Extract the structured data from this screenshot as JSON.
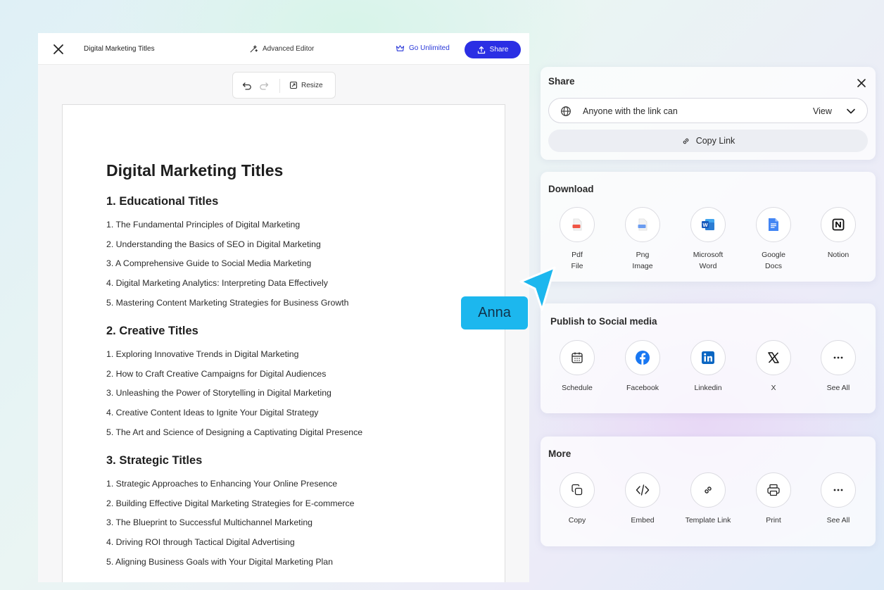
{
  "editor": {
    "doc_name": "Digital Marketing Titles",
    "advanced_editor": "Advanced Editor",
    "go_unlimited": "Go Unlimited",
    "share": "Share",
    "resize": "Resize"
  },
  "document": {
    "title": "Digital Marketing Titles",
    "sections": [
      {
        "heading": "1. Educational Titles",
        "items": [
          "1. The Fundamental Principles of Digital Marketing",
          "2. Understanding the Basics of SEO in Digital Marketing",
          "3. A Comprehensive Guide to Social Media Marketing",
          "4. Digital Marketing Analytics: Interpreting Data Effectively",
          "5. Mastering Content Marketing Strategies for Business Growth"
        ]
      },
      {
        "heading": "2. Creative Titles",
        "items": [
          "1. Exploring Innovative Trends in Digital Marketing",
          "2. How to Craft Creative Campaigns for Digital Audiences",
          "3. Unleashing the Power of Storytelling in Digital Marketing",
          "4. Creative Content Ideas to Ignite Your Digital Strategy",
          "5. The Art and Science of Designing a Captivating Digital Presence"
        ]
      },
      {
        "heading": "3. Strategic Titles",
        "items": [
          "1. Strategic Approaches to Enhancing Your Online Presence",
          "2. Building Effective Digital Marketing Strategies for E-commerce",
          "3. The Blueprint to Successful Multichannel Marketing",
          "4. Driving ROI through Tactical Digital Advertising",
          "5. Aligning Business Goals with Your Digital Marketing Plan"
        ]
      }
    ]
  },
  "share_panel": {
    "title": "Share",
    "permission_text": "Anyone with the link can",
    "permission_value": "View",
    "copy_link": "Copy Link"
  },
  "download_panel": {
    "title": "Download",
    "options": [
      {
        "line1": "Pdf",
        "line2": "File",
        "icon": "pdf-file-icon"
      },
      {
        "line1": "Png",
        "line2": "Image",
        "icon": "png-image-icon"
      },
      {
        "line1": "Microsoft",
        "line2": "Word",
        "icon": "microsoft-word-icon"
      },
      {
        "line1": "Google",
        "line2": "Docs",
        "icon": "google-docs-icon"
      },
      {
        "line1": "Notion",
        "line2": "",
        "icon": "notion-icon"
      }
    ]
  },
  "social_panel": {
    "title": "Publish to Social media",
    "options": [
      {
        "label": "Schedule",
        "icon": "calendar-icon"
      },
      {
        "label": "Facebook",
        "icon": "facebook-icon"
      },
      {
        "label": "Linkedin",
        "icon": "linkedin-icon"
      },
      {
        "label": "X",
        "icon": "x-icon"
      },
      {
        "label": "See All",
        "icon": "more-icon"
      }
    ]
  },
  "more_panel": {
    "title": "More",
    "options": [
      {
        "label": "Copy",
        "icon": "copy-icon"
      },
      {
        "label": "Embed",
        "icon": "embed-code-icon"
      },
      {
        "label": "Template Link",
        "icon": "link-icon"
      },
      {
        "label": "Print",
        "icon": "printer-icon"
      },
      {
        "label": "See All",
        "icon": "more-icon"
      }
    ]
  },
  "cursor_tag": "Anna",
  "colors": {
    "accent": "#2b2fe4",
    "cursor": "#1cb7ee",
    "facebook": "#1877f2",
    "linkedin": "#0a66c2",
    "word": "#185abd",
    "google_docs": "#4285f4",
    "pdf": "#f05545"
  }
}
